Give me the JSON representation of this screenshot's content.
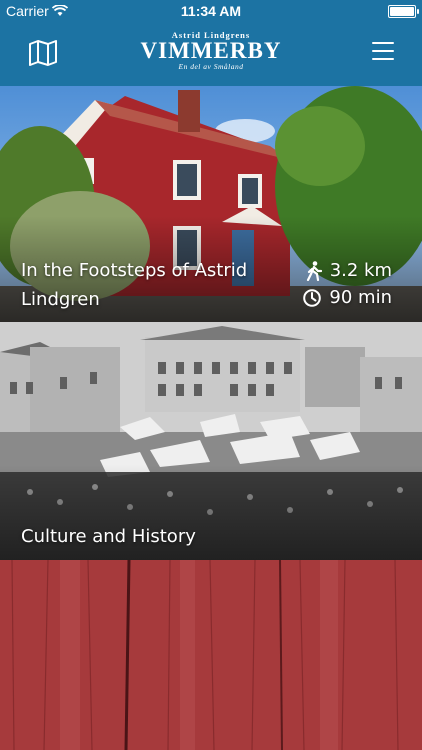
{
  "status_bar": {
    "carrier": "Carrier",
    "time": "11:34 AM",
    "battery_level": 1.0
  },
  "header": {
    "logo_pre": "Astrid Lindgrens",
    "logo_main": "VIMMERBY",
    "logo_sub": "En del av Småland",
    "left_icon": "map-icon",
    "right_icon": "hamburger-menu-icon"
  },
  "cards": [
    {
      "title": "In the Footsteps of Astrid Lindgren",
      "distance": "3.2 km",
      "duration": "90 min",
      "distance_icon": "walking-person-icon",
      "duration_icon": "clock-icon"
    },
    {
      "title": "Culture and History"
    },
    {
      "title": ""
    }
  ],
  "colors": {
    "brand_blue": "#1c73a3",
    "house_red": "#a8272c",
    "wood_red": "#a63a3c"
  }
}
